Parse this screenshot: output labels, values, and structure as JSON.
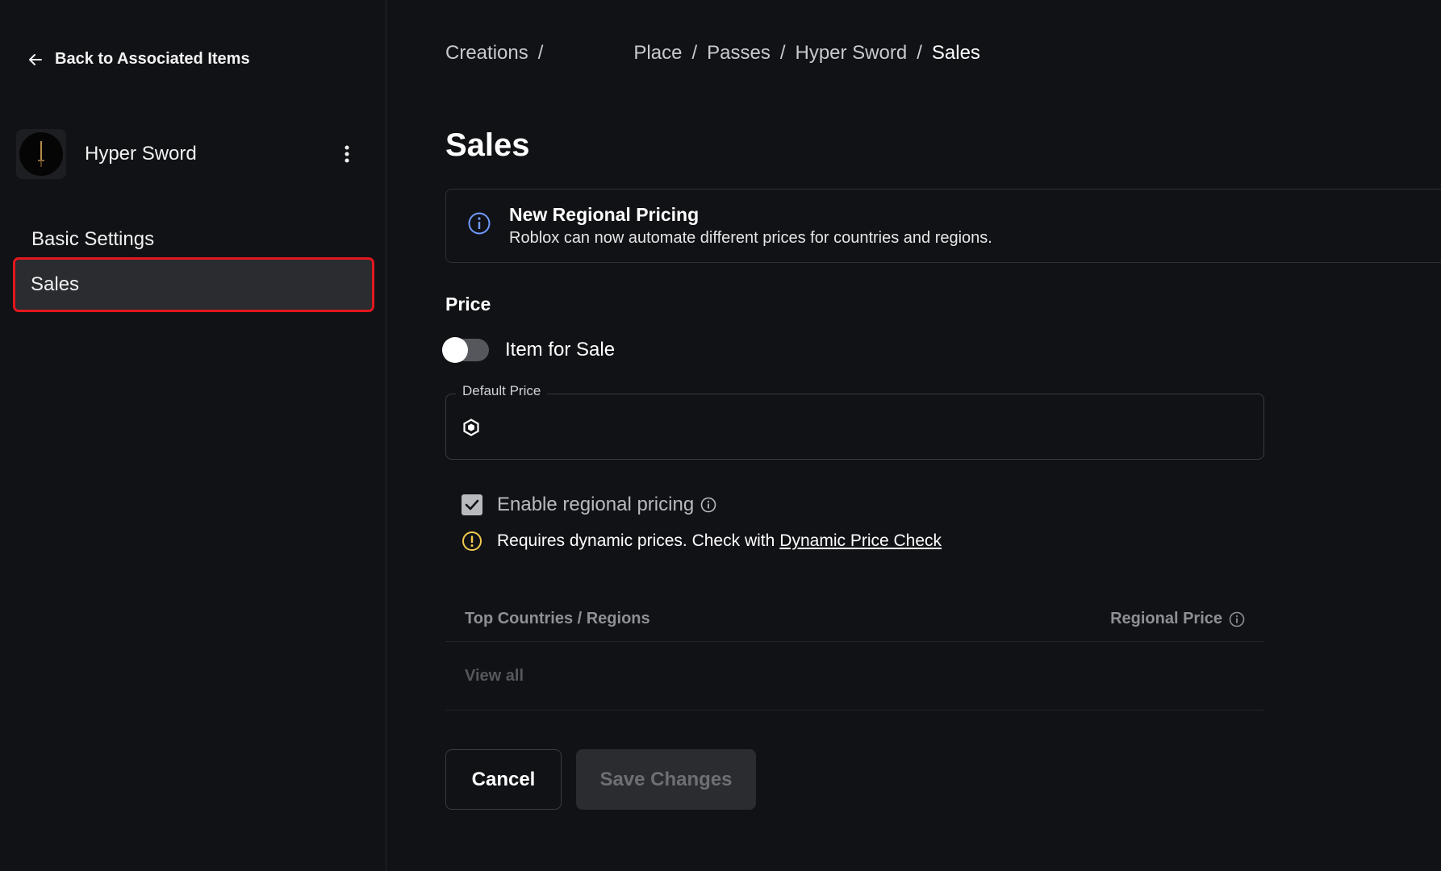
{
  "sidebar": {
    "back_label": "Back to Associated Items",
    "item_name": "Hyper Sword",
    "nav": [
      {
        "label": "Basic Settings"
      },
      {
        "label": "Sales"
      }
    ]
  },
  "breadcrumb": {
    "items": [
      "Creations",
      "Place",
      "Passes",
      "Hyper Sword",
      "Sales"
    ],
    "separator": "/"
  },
  "page": {
    "title": "Sales"
  },
  "banner": {
    "title": "New Regional Pricing",
    "text": "Roblox can now automate different prices for countries and regions."
  },
  "price": {
    "section_label": "Price",
    "toggle_label": "Item for Sale",
    "default_price_label": "Default Price",
    "default_price_value": "",
    "regional_label": "Enable regional pricing",
    "warning_text": "Requires dynamic prices. Check with",
    "warning_link": "Dynamic Price Check"
  },
  "table": {
    "col_left": "Top Countries / Regions",
    "col_right": "Regional Price",
    "view_all": "View all"
  },
  "actions": {
    "cancel": "Cancel",
    "save": "Save Changes"
  },
  "colors": {
    "background": "#111216",
    "selected_outline": "#e2171e",
    "info_blue": "#6f9bff",
    "warning_yellow": "#f2c94c"
  }
}
